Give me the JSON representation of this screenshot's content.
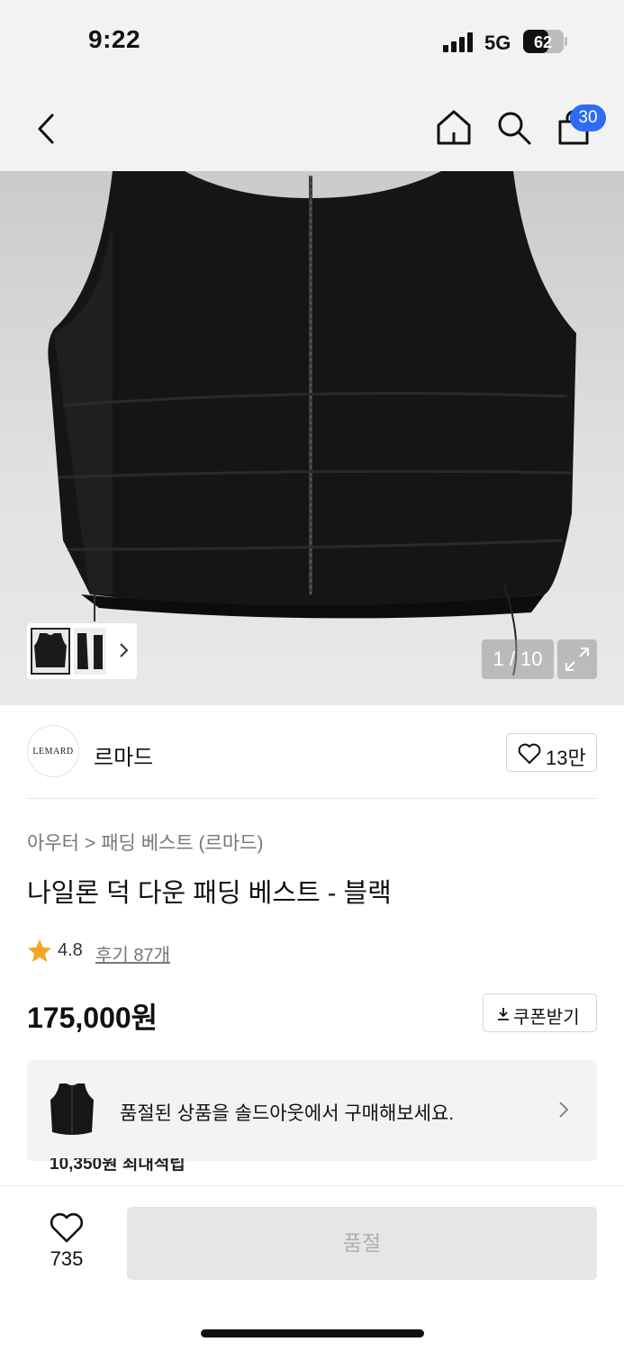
{
  "status_bar": {
    "time": "9:22",
    "network": "5G",
    "battery": "62"
  },
  "nav": {
    "bag_badge": "30"
  },
  "gallery": {
    "counter": "1 / 10"
  },
  "brand": {
    "logo_text": "LEMARD",
    "name": "르마드",
    "likes": "13만"
  },
  "breadcrumb": {
    "category": "아우터",
    "subcategory": "패딩 베스트 (르마드)"
  },
  "product": {
    "title": "나일론 덕 다운 패딩 베스트 - 블랙",
    "rating": "4.8",
    "reviews": "후기 87개",
    "price": "175,000원",
    "coupon_label": "쿠폰받기"
  },
  "soldout_banner": {
    "text": "품절된 상품을 솔드아웃에서 구매해보세요."
  },
  "points": {
    "text": "10,350원 최대적립"
  },
  "bottom": {
    "wish_count": "735",
    "buy_label": "품절"
  },
  "colors": {
    "badge": "#2f6bf5",
    "star": "#f5a623",
    "disabled_button": "#e6e6e6"
  }
}
